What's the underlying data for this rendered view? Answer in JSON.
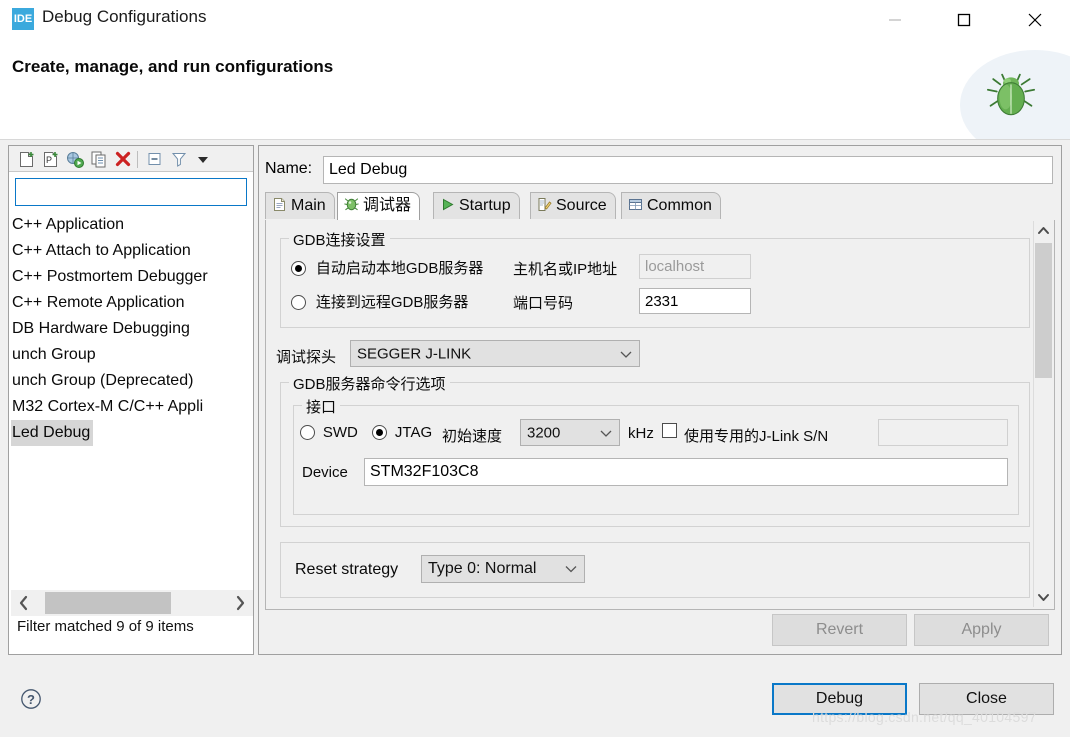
{
  "window": {
    "app_icon_text": "IDE",
    "title": "Debug Configurations",
    "controls": {
      "minimize": "minimize-icon",
      "maximize": "maximize-icon",
      "close": "close-icon"
    }
  },
  "header": {
    "title": "Create, manage, and run configurations",
    "art_icon": "bug-icon"
  },
  "left_panel": {
    "toolbar": [
      {
        "name": "new-configuration-icon",
        "tooltip": "New launch configuration"
      },
      {
        "name": "new-prototype-icon",
        "tooltip": "New prototype"
      },
      {
        "name": "new-launch-group-icon",
        "tooltip": "New launch group"
      },
      {
        "name": "duplicate-icon",
        "tooltip": "Duplicate"
      },
      {
        "name": "delete-icon",
        "tooltip": "Delete"
      },
      {
        "name": "collapse-all-icon",
        "tooltip": "Collapse All"
      },
      {
        "name": "filter-icon",
        "tooltip": "Filter"
      },
      {
        "name": "view-menu-icon",
        "tooltip": "View Menu"
      }
    ],
    "filter": {
      "value": "",
      "placeholder": ""
    },
    "items": [
      {
        "label": "C++ Application",
        "selected": false
      },
      {
        "label": "C++ Attach to Application",
        "selected": false
      },
      {
        "label": "C++ Postmortem Debugger",
        "selected": false
      },
      {
        "label": "C++ Remote Application",
        "selected": false
      },
      {
        "label": "DB Hardware Debugging",
        "selected": false
      },
      {
        "label": "unch Group",
        "selected": false
      },
      {
        "label": "unch Group (Deprecated)",
        "selected": false
      },
      {
        "label": "M32 Cortex-M C/C++ Appli",
        "selected": false
      },
      {
        "label": "Led Debug",
        "selected": true
      }
    ],
    "status": "Filter matched 9 of 9 items"
  },
  "right_panel": {
    "name_label": "Name:",
    "name_value": "Led Debug",
    "tabs": [
      {
        "label": "Main",
        "icon": "document-icon",
        "active": false
      },
      {
        "label": "调试器",
        "icon": "debugger-bug-icon",
        "active": true
      },
      {
        "label": "Startup",
        "icon": "run-arrow-icon",
        "active": false
      },
      {
        "label": "Source",
        "icon": "source-pencil-icon",
        "active": false
      },
      {
        "label": "Common",
        "icon": "table-icon",
        "active": false
      }
    ],
    "gdb_connection": {
      "group_title": "GDB连接设置",
      "auto_start_label": "自动启动本地GDB服务器",
      "auto_start_selected": true,
      "host_label": "主机名或IP地址",
      "host_value": "localhost",
      "host_disabled": true,
      "remote_label": "连接到远程GDB服务器",
      "remote_selected": false,
      "port_label": "端口号码",
      "port_value": "2331"
    },
    "probe": {
      "label": "调试探头",
      "value": "SEGGER J-LINK"
    },
    "gdb_server_options": {
      "group_title": "GDB服务器命令行选项",
      "interface": {
        "group_title": "接口",
        "swd_label": "SWD",
        "swd_selected": false,
        "jtag_label": "JTAG",
        "jtag_selected": true,
        "speed_label": "初始速度",
        "speed_value": "3200",
        "speed_unit": "kHz",
        "sn_checkbox_label": "使用专用的J-Link S/N",
        "sn_checked": false,
        "sn_value": "",
        "device_label": "Device",
        "device_value": "STM32F103C8"
      },
      "reset_strategy_label": "Reset strategy",
      "reset_strategy_value": "Type 0: Normal"
    },
    "buttons": {
      "revert": "Revert",
      "revert_enabled": false,
      "apply": "Apply",
      "apply_enabled": false
    }
  },
  "footer": {
    "help_icon": "help-icon",
    "debug_button": "Debug",
    "close_button": "Close",
    "watermark": "https://blog.csdn.net/qq_40104597"
  },
  "colors": {
    "accent": "#0a78c8",
    "app_icon_bg": "#3ba9dd",
    "selection": "#d6d6d6",
    "delete_icon": "#cc2222",
    "bug_green": "#5aa council"
  }
}
